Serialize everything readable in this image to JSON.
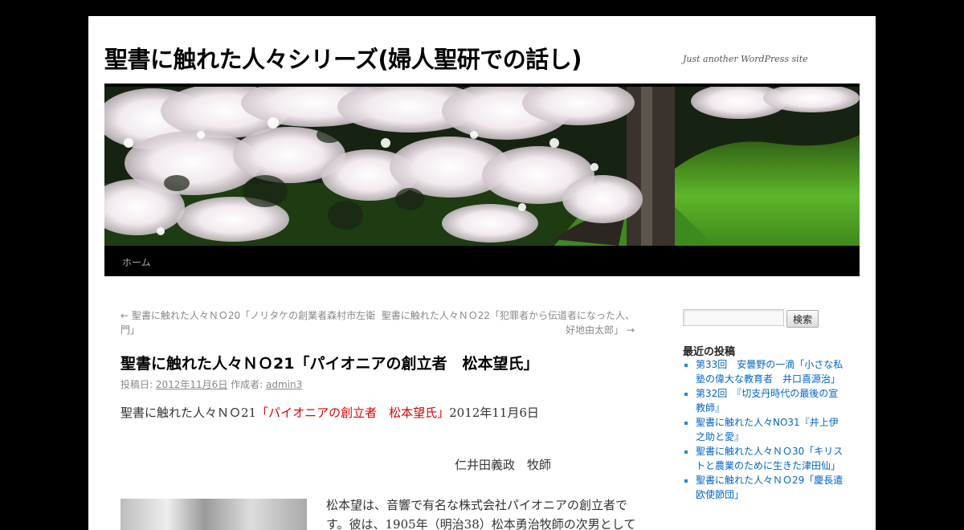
{
  "site": {
    "title": "聖書に触れた人々シリーズ(婦人聖研での話し)",
    "description": "Just another WordPress site"
  },
  "nav": {
    "home": "ホーム"
  },
  "post_nav": {
    "prev": "← 聖書に触れた人々ＮＯ20「ノリタケの創業者森村市左衛門」",
    "next": "聖書に触れた人々ＮＯ22「犯罪者から伝道者になった人、好地由太郎」 →"
  },
  "post": {
    "title": "聖書に触れた人々ＮＯ21「パイオニアの創立者　松本望氏」",
    "meta_prefix": "投稿日:",
    "date": "2012年11月6日",
    "meta_author_label": "作成者:",
    "author": "admin3",
    "intro_prefix": "聖書に触れた人々ＮＯ21",
    "intro_highlight": "「パイオニアの創立者　松本望氏」",
    "intro_suffix": "2012年11月6日",
    "pastor": "仁井田義政　牧師",
    "paragraph": "松本望は、音響で有名な株式会社パイオニアの創立者です。彼は、1905年（明治38）松本勇治牧師の次男として"
  },
  "sidebar": {
    "search_placeholder": "",
    "search_button": "検索",
    "recent_heading": "最近の投稿",
    "recent_posts": [
      "第33回　安曇野の一滴「小さな私塾の偉大な教育者　井口喜源治」",
      "第32回　『切支丹時代の最後の宣教師』",
      "聖書に触れた人々NO31『井上伊之助と愛』",
      "聖書に触れた人々ＮＯ30「キリストと農業のために生きた津田仙」",
      "聖書に触れた人々ＮＯ29「慶長遣欧使節団」"
    ]
  },
  "colors": {
    "background": "#000000",
    "accent_link": "#0066cc",
    "highlight_red": "#e00000"
  }
}
